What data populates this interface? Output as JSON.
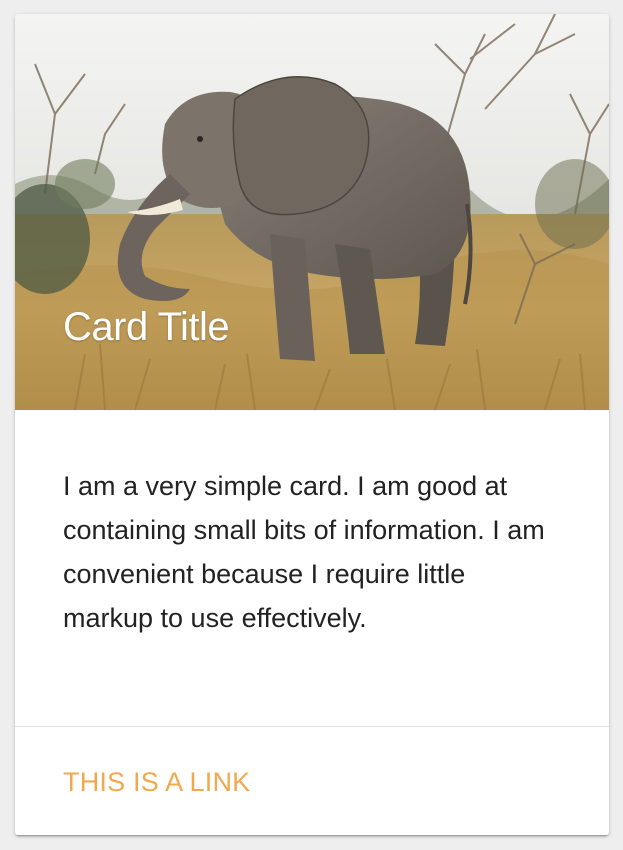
{
  "card": {
    "image_subject": "elephant-photo",
    "title": "Card Title",
    "body": "I am a very simple card. I am good at containing small bits of information. I am convenient because I require little markup to use effectively.",
    "link_label": "THIS IS A LINK"
  },
  "colors": {
    "link": "#f2a94e",
    "title": "#ffffff",
    "body_text": "#222222",
    "page_background": "#eeeeee",
    "card_background": "#ffffff"
  }
}
